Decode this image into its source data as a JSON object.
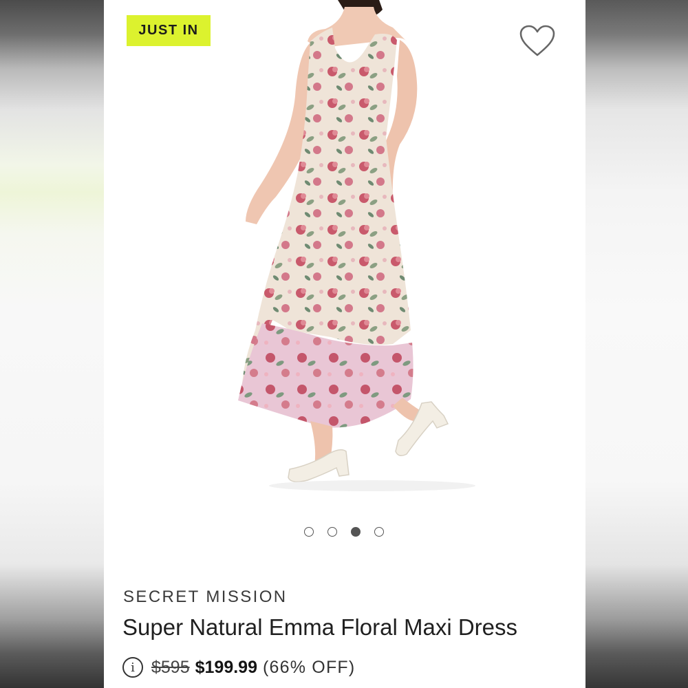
{
  "badge": {
    "label": "JUST IN"
  },
  "icons": {
    "favorite": "heart-outline-icon",
    "info": "info-circle-icon"
  },
  "carousel": {
    "count": 4,
    "active_index": 2
  },
  "product": {
    "brand": "SECRET MISSION",
    "title": "Super Natural Emma Floral Maxi Dress",
    "original_price": "$595",
    "sale_price": "$199.99",
    "discount": "(66% OFF)"
  },
  "colors": {
    "badge_bg": "#dcf22e",
    "dress_base": "#efe3d6",
    "dress_floral": "#c9566a",
    "dress_hem": "#e6c3d4"
  }
}
